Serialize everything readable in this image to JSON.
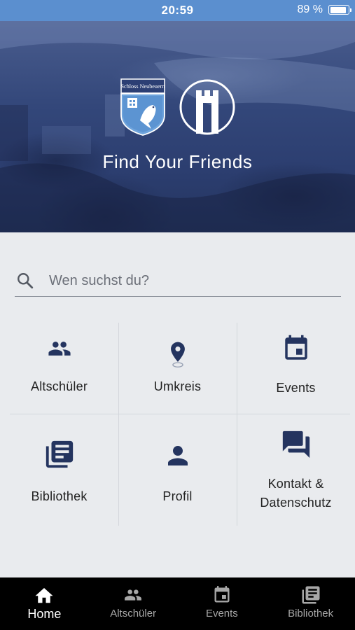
{
  "status_bar": {
    "time": "20:59",
    "battery": "89 %",
    "battery_level": 0.89
  },
  "hero": {
    "crest_text": "Schloss Neubeuern",
    "title": "Find Your Friends"
  },
  "search": {
    "placeholder": "Wen suchst du?",
    "value": ""
  },
  "tiles": [
    {
      "label": "Altschüler",
      "icon": "group-icon"
    },
    {
      "label": "Umkreis",
      "icon": "location-pin-icon"
    },
    {
      "label": "Events",
      "icon": "calendar-icon"
    },
    {
      "label": "Bibliothek",
      "icon": "library-icon"
    },
    {
      "label": "Profil",
      "icon": "person-icon"
    },
    {
      "label_line1": "Kontakt &",
      "label_line2": "Datenschutz",
      "icon": "chat-icon"
    }
  ],
  "bottom_nav": [
    {
      "label": "Home",
      "icon": "home-icon",
      "active": true
    },
    {
      "label": "Altschüler",
      "icon": "group-icon"
    },
    {
      "label": "Events",
      "icon": "calendar-icon"
    },
    {
      "label": "Bibliothek",
      "icon": "library-icon"
    }
  ],
  "colors": {
    "accent": "#24345f",
    "status_bar": "#5b8fcf",
    "background": "#e9ebee",
    "nav_background": "#000000"
  }
}
